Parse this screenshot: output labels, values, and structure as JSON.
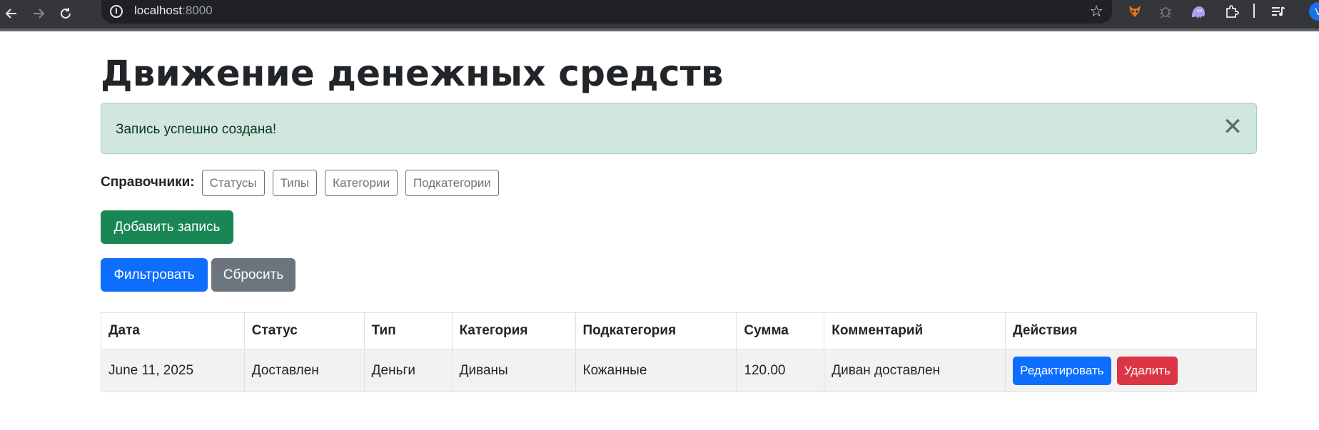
{
  "browser": {
    "url_host": "localhost",
    "url_port": ":8000",
    "profile_initial": "V",
    "icons": {
      "back": "arrow-left-icon",
      "forward": "arrow-right-icon",
      "reload": "reload-icon",
      "site_info": "info-icon",
      "bookmark": "star-icon",
      "extensions": [
        "fox-extension-icon",
        "bug-extension-icon",
        "ghost-extension-icon",
        "puzzle-icon",
        "media-control-icon"
      ]
    }
  },
  "page": {
    "title": "Движение денежных средств",
    "alert": {
      "message": "Запись успешно создана!",
      "close_glyph": "✕",
      "colors": {
        "background": "#d1e7dd",
        "text": "#0a3622"
      }
    },
    "references": {
      "label": "Справочники:",
      "items": [
        "Статусы",
        "Типы",
        "Категории",
        "Подкатегории"
      ]
    },
    "buttons": {
      "add": "Добавить запись",
      "filter": "Фильтровать",
      "reset": "Сбросить"
    },
    "table": {
      "headers": [
        "Дата",
        "Статус",
        "Тип",
        "Категория",
        "Подкатегория",
        "Сумма",
        "Комментарий",
        "Действия"
      ],
      "rows": [
        {
          "date": "June 11, 2025",
          "status": "Доставлен",
          "type": "Деньги",
          "category": "Диваны",
          "subcategory": "Кожанные",
          "amount": "120.00",
          "comment": "Диван доставлен",
          "edit_label": "Редактировать",
          "delete_label": "Удалить"
        }
      ]
    },
    "colors": {
      "primary": "#0d6efd",
      "success": "#198754",
      "secondary": "#6c757d",
      "danger": "#dc3545"
    }
  }
}
